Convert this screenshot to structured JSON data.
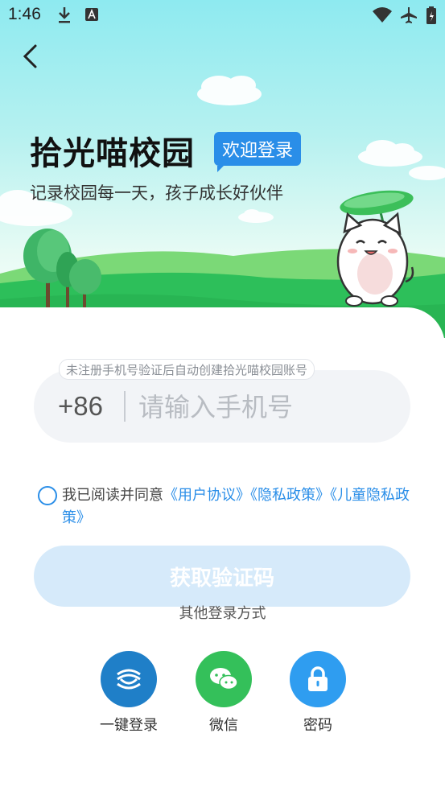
{
  "status_bar": {
    "time": "1:46"
  },
  "header": {
    "app_title": "拾光喵校园",
    "badge": "欢迎登录",
    "subtitle": "记录校园每一天，孩子成长好伙伴"
  },
  "form": {
    "hint": "未注册手机号验证后自动创建拾光喵校园账号",
    "country_code": "+86",
    "phone_placeholder": "请输入手机号",
    "phone_value": ""
  },
  "agreement": {
    "prefix": "我已阅读并同意",
    "user_agreement": "《用户协议》",
    "privacy_policy": "《隐私政策》",
    "child_privacy": "《儿童隐私政策》"
  },
  "actions": {
    "get_code": "获取验证码",
    "other_login": "其他登录方式",
    "options": [
      {
        "label": "一键登录",
        "icon": "china-mobile-icon",
        "color": "#1f7fc8"
      },
      {
        "label": "微信",
        "icon": "wechat-icon",
        "color": "#34c05a"
      },
      {
        "label": "密码",
        "icon": "lock-icon",
        "color": "#2f9df0"
      }
    ]
  },
  "colors": {
    "accent": "#2a8ee8",
    "button_disabled": "#d6eafa",
    "grass": "#2dbf5a"
  }
}
